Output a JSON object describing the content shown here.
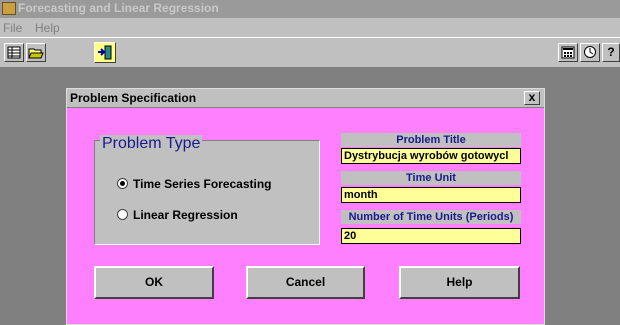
{
  "window": {
    "title": "Forecasting and Linear Regression"
  },
  "menu": [
    "File",
    "Help"
  ],
  "toolbar": {
    "left_icons": [
      "table-icon",
      "open-folder-icon",
      "exit-icon"
    ],
    "right_icons": [
      "calculator-icon",
      "clock-icon",
      "help-icon"
    ]
  },
  "dialog": {
    "title": "Problem Specification",
    "close_label": "x",
    "problem_type": {
      "legend": "Problem Type",
      "options": [
        {
          "label": "Time Series Forecasting",
          "selected": true
        },
        {
          "label": "Linear Regression",
          "selected": false
        }
      ]
    },
    "fields": {
      "problem_title_label": "Problem Title",
      "problem_title_value": "Dystrybucja wyrobów gotowycl",
      "time_unit_label": "Time Unit",
      "time_unit_value": "month",
      "num_units_label": "Number of Time Units (Periods)",
      "num_units_value": "20"
    },
    "buttons": {
      "ok": "OK",
      "cancel": "Cancel",
      "help": "Help"
    }
  },
  "colors": {
    "dialog_bg": "#ff80ff",
    "input_bg": "#ffff99",
    "label_text": "#1a1a8c",
    "workspace": "#808080"
  }
}
